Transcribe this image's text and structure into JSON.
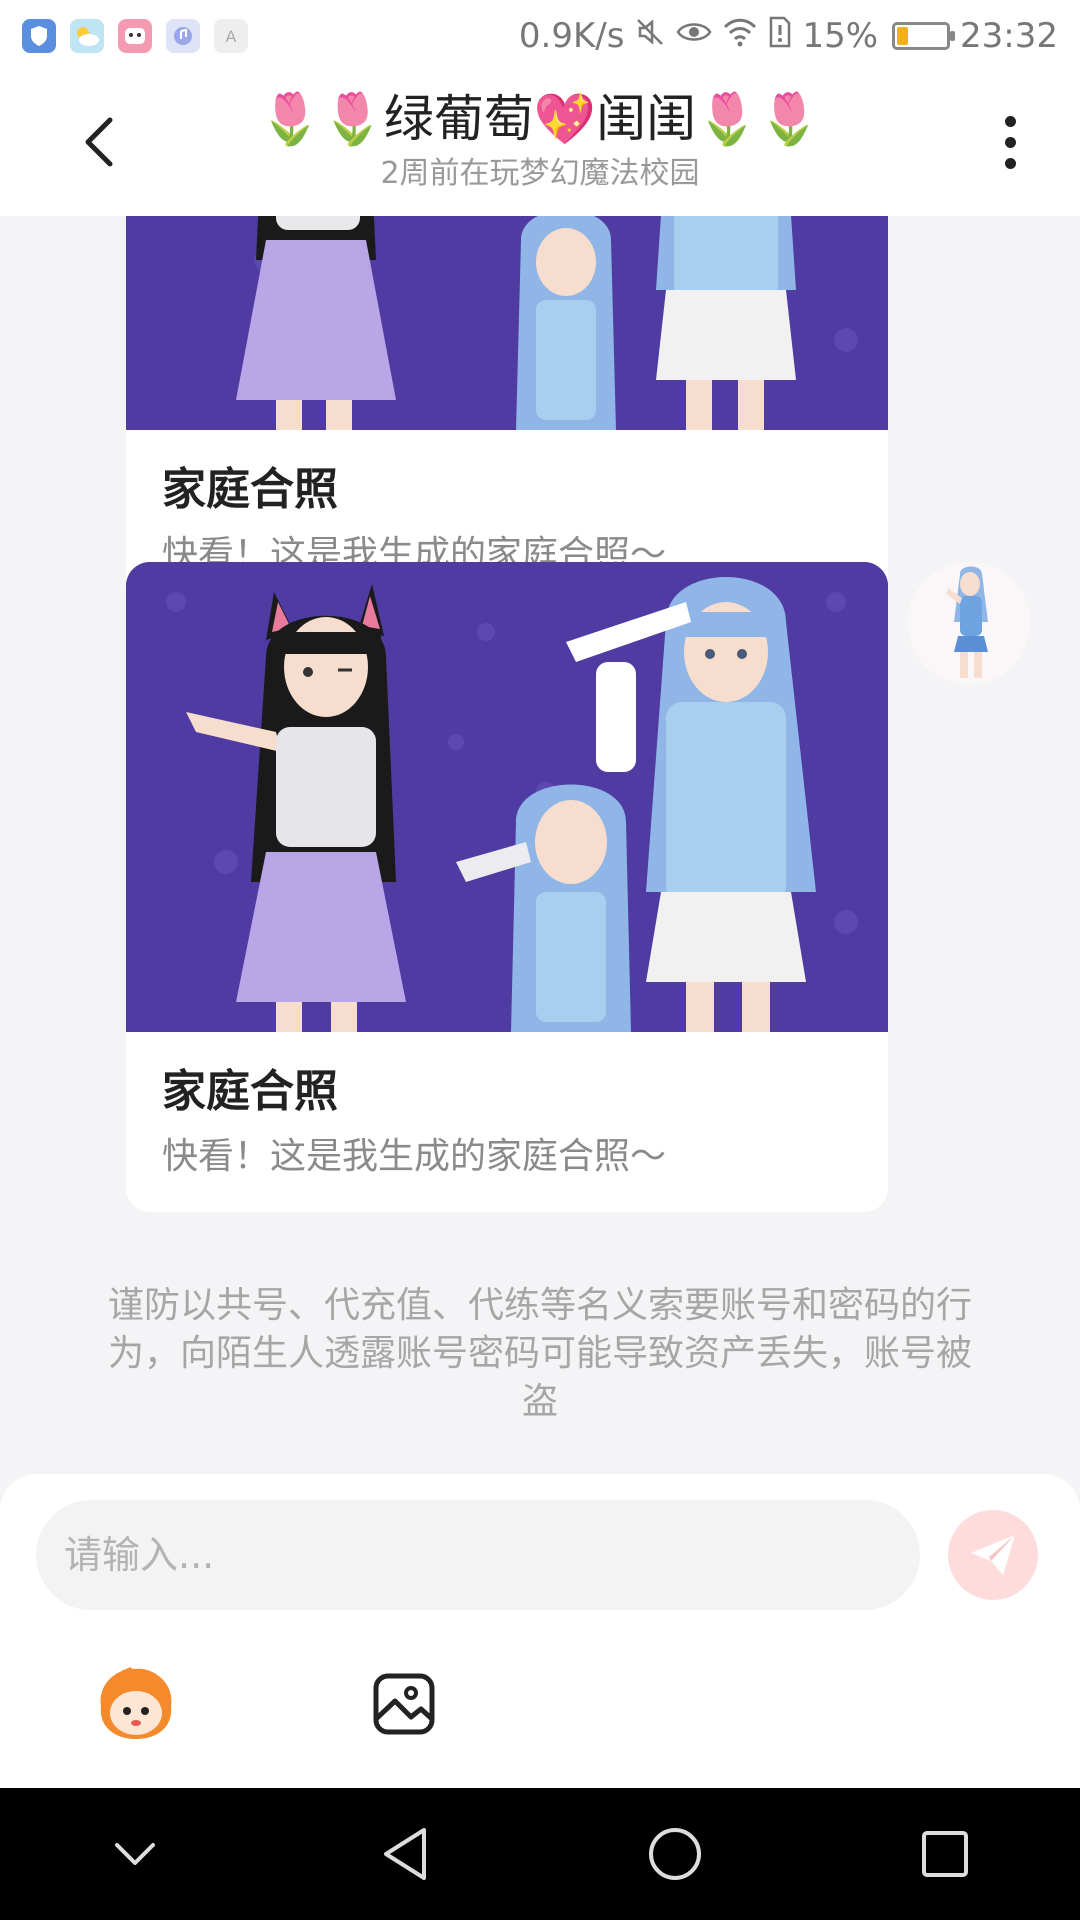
{
  "status_bar": {
    "network_speed": "0.9K/s",
    "battery_percent": "15%",
    "time": "23:32",
    "icons": [
      "app-shield-icon",
      "weather-icon",
      "app-face-icon",
      "music-icon",
      "text-icon"
    ],
    "right_icons": [
      "mute-icon",
      "eye-icon",
      "wifi-icon",
      "sim-alert-icon",
      "battery-icon"
    ]
  },
  "header": {
    "title": "🌷🌷绿葡萄💖闺闺🌷🌷",
    "subtitle": "2周前在玩梦幻魔法校园"
  },
  "messages": [
    {
      "title": "家庭合照",
      "desc": "快看！这是我生成的家庭合照～"
    },
    {
      "title": "家庭合照",
      "desc": "快看！这是我生成的家庭合照～"
    }
  ],
  "notice": "谨防以共号、代充值、代练等名义索要账号和密码的行为，向陌生人透露账号密码可能导致资产丢失，账号被盗",
  "input": {
    "placeholder": "请输入..."
  },
  "colors": {
    "image_bg": "#4f3ba1",
    "send_bg": "#ffdcdc",
    "send_icon": "#ffffff"
  }
}
